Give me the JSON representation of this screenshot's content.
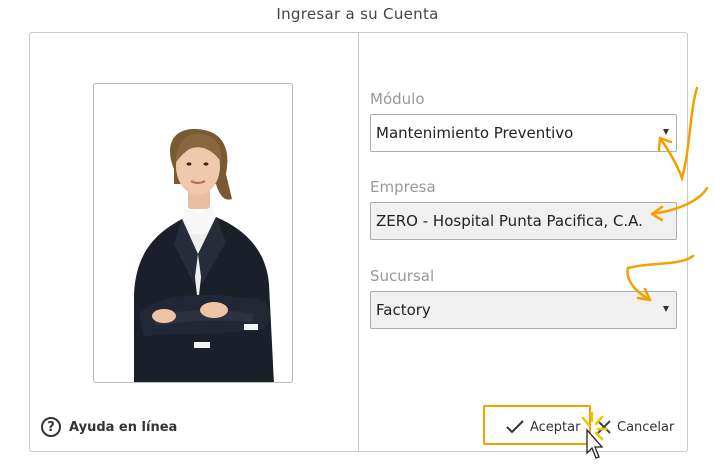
{
  "dialog": {
    "title": "Ingresar a su Cuenta"
  },
  "form": {
    "modulo": {
      "label": "Módulo",
      "value": "Mantenimiento Preventivo"
    },
    "empresa": {
      "label": "Empresa",
      "value": "ZERO - Hospital Punta Pacifica, C.A."
    },
    "sucursal": {
      "label": "Sucursal",
      "value": "Factory"
    }
  },
  "footer": {
    "help_label": "Ayuda en línea",
    "help_icon_text": "?",
    "accept_label": "Aceptar",
    "cancel_label": "Cancelar"
  },
  "icons": {
    "help": "question-circle-icon",
    "accept": "check-icon",
    "cancel": "x-icon",
    "annotation_arrow": "curved-arrow-icon",
    "cursor": "mouse-pointer-icon"
  },
  "colors": {
    "annotation": "#f59f00",
    "border": "#c9c9c9",
    "label": "#999999",
    "disabled_select_bg": "#f0f0f0"
  }
}
